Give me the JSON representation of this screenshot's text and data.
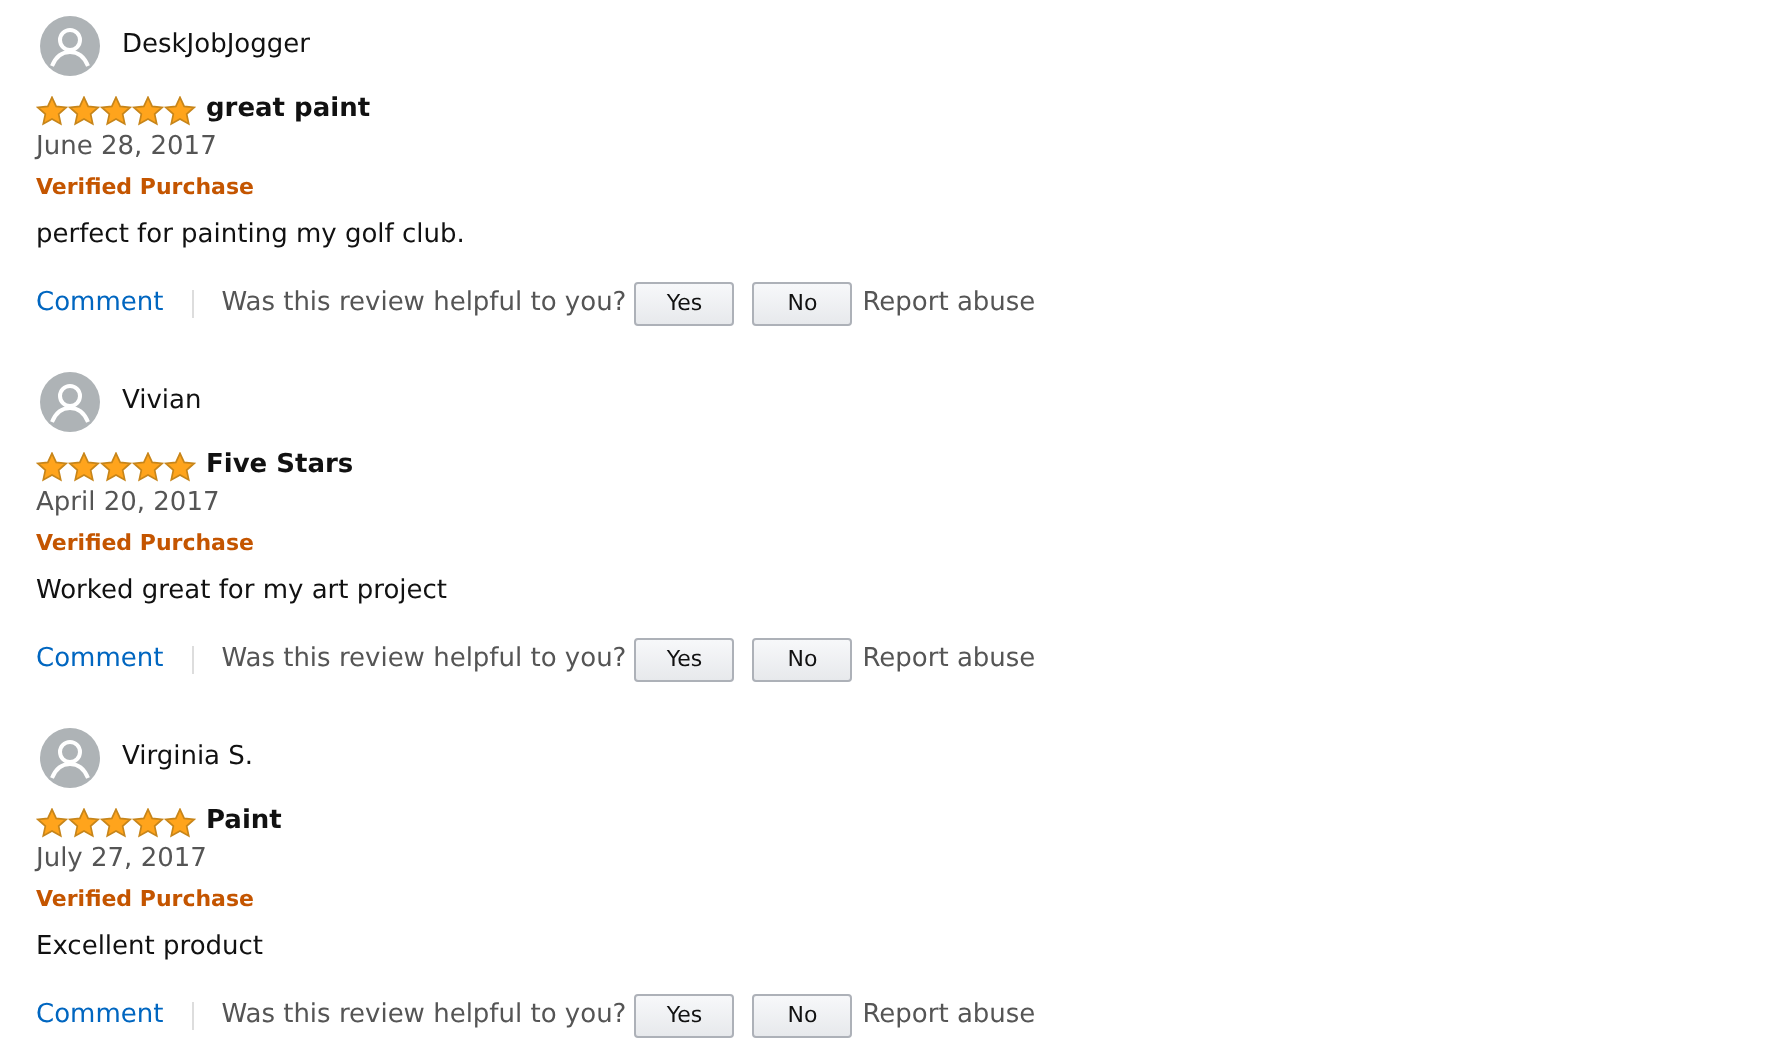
{
  "reviews": [
    {
      "author": "DeskJobJogger",
      "stars": 5,
      "title": "great paint",
      "date": "June 28, 2017",
      "badge": "Verified Purchase",
      "body": "perfect for painting my golf club.",
      "comment": "Comment",
      "helpful_prompt": "Was this review helpful to you?",
      "yes": "Yes",
      "no": "No",
      "report": "Report abuse"
    },
    {
      "author": "Vivian",
      "stars": 5,
      "title": "Five Stars",
      "date": "April 20, 2017",
      "badge": "Verified Purchase",
      "body": "Worked great for my art project",
      "comment": "Comment",
      "helpful_prompt": "Was this review helpful to you?",
      "yes": "Yes",
      "no": "No",
      "report": "Report abuse"
    },
    {
      "author": "Virginia S.",
      "stars": 5,
      "title": "Paint",
      "date": "July 27, 2017",
      "badge": "Verified Purchase",
      "body": "Excellent product",
      "comment": "Comment",
      "helpful_prompt": "Was this review helpful to you?",
      "yes": "Yes",
      "no": "No",
      "report": "Report abuse"
    }
  ]
}
